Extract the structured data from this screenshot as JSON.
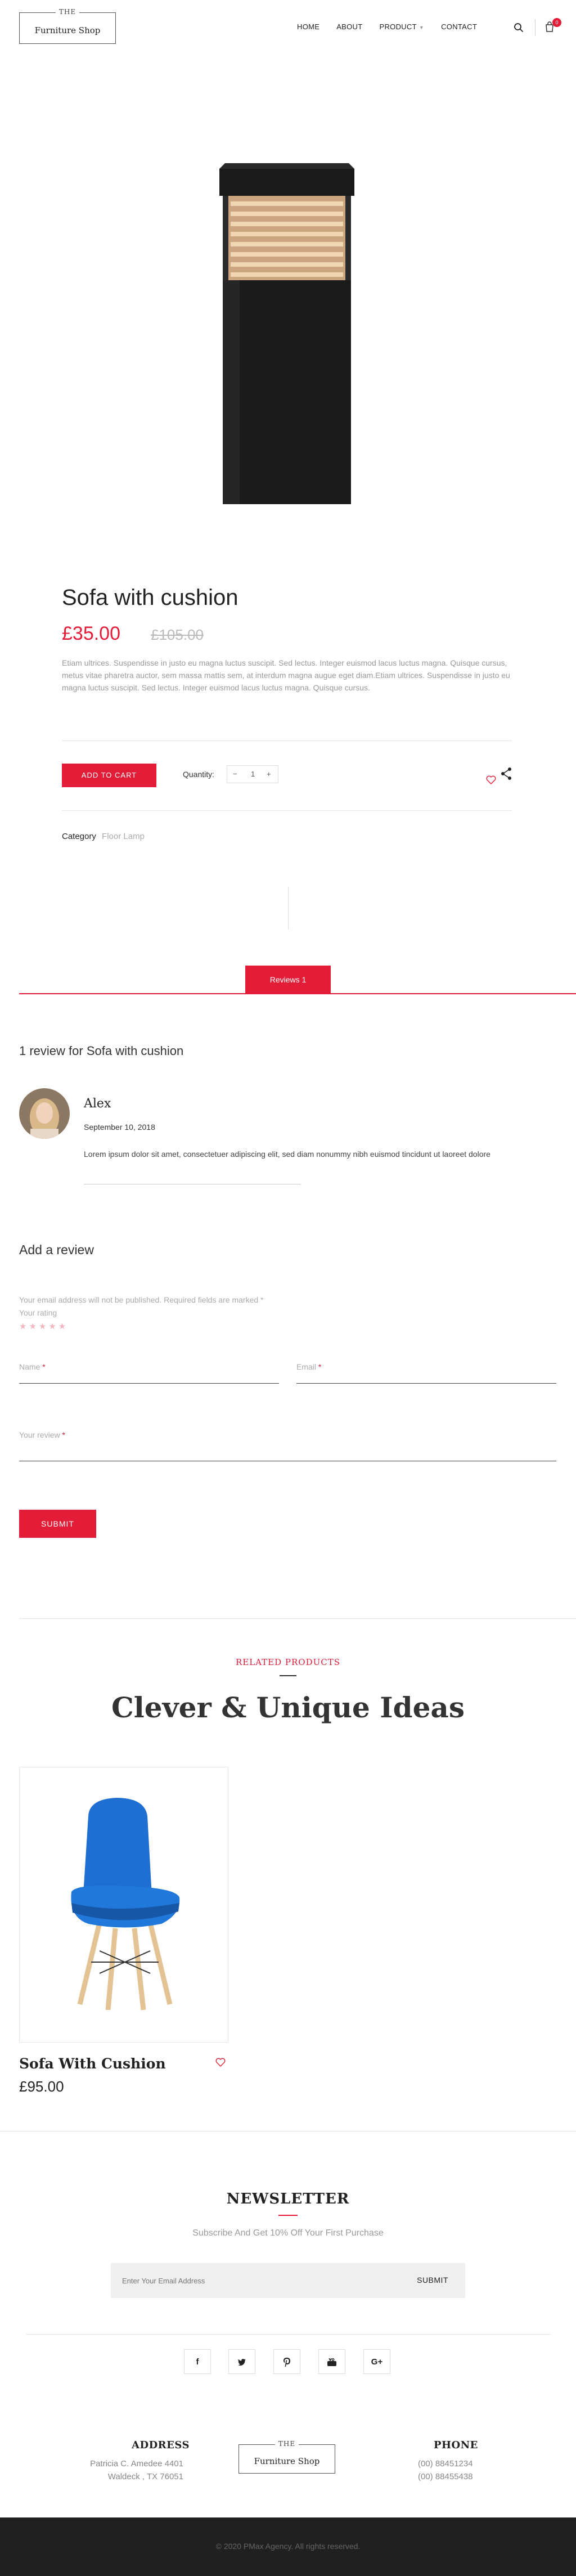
{
  "header": {
    "logo_the": "THE",
    "logo_name": "Furniture Shop",
    "nav": [
      "HOME",
      "ABOUT",
      "PRODUCT",
      "CONTACT"
    ],
    "cart_count": "0"
  },
  "product": {
    "title": "Sofa with cushion",
    "price": "£35.00",
    "old_price": "£105.00",
    "description": "Etiam ultrices. Suspendisse in justo eu magna luctus suscipit. Sed lectus. Integer euismod lacus luctus magna. Quisque cursus, metus vitae pharetra auctor, sem massa mattis sem, at interdum magna augue eget diam.Etiam ultrices. Suspendisse in justo eu magna luctus suscipit. Sed lectus. Integer euismod lacus luctus magna. Quisque cursus.",
    "add_to_cart": "ADD TO CART",
    "quantity_label": "Quantity:",
    "quantity_value": "1",
    "qty_minus": "−",
    "qty_plus": "+",
    "category_label": "Category",
    "category_value": "Floor Lamp"
  },
  "tabs": {
    "reviews": "Reviews 1"
  },
  "reviews": {
    "count_title": "1 review for Sofa with cushion",
    "items": [
      {
        "author": "Alex",
        "date": "September 10, 2018",
        "text": "Lorem ipsum dolor sit amet, consectetuer adipiscing elit, sed diam nonummy nibh euismod tincidunt ut laoreet dolore"
      }
    ]
  },
  "review_form": {
    "title": "Add a review",
    "notice": "Your email address will not be published. Required fields are marked *",
    "rating_label": "Your rating",
    "stars": "★★★★★",
    "name_label": "Name",
    "email_label": "Email",
    "review_label": "Your review",
    "required_mark": "*",
    "submit": "SUBMIT"
  },
  "related": {
    "kicker": "RELATED PRODUCTS",
    "title": "Clever & Unique Ideas",
    "products": [
      {
        "title": "Sofa With Cushion",
        "price": "£95.00"
      }
    ]
  },
  "newsletter": {
    "title": "NEWSLETTER",
    "subtitle": "Subscribe And Get 10% Off Your First Purchase",
    "placeholder": "Enter Your Email Address",
    "submit": "SUBMIT"
  },
  "social": [
    "f",
    "t",
    "p",
    "yt",
    "G+"
  ],
  "footer": {
    "address_title": "ADDRESS",
    "address_lines": [
      "Patricia C. Amedee 4401",
      "Waldeck , TX 76051"
    ],
    "logo_the": "THE",
    "logo_name": "Furniture Shop",
    "phone_title": "PHONE",
    "phone_lines": [
      "(00) 88451234",
      "(00) 88455438"
    ],
    "copyright": "© 2020 PMax Agency. All rights reserved."
  },
  "colors": {
    "accent": "#e31c38",
    "footer_bg": "#202020",
    "chair": "#1e6fd1"
  }
}
